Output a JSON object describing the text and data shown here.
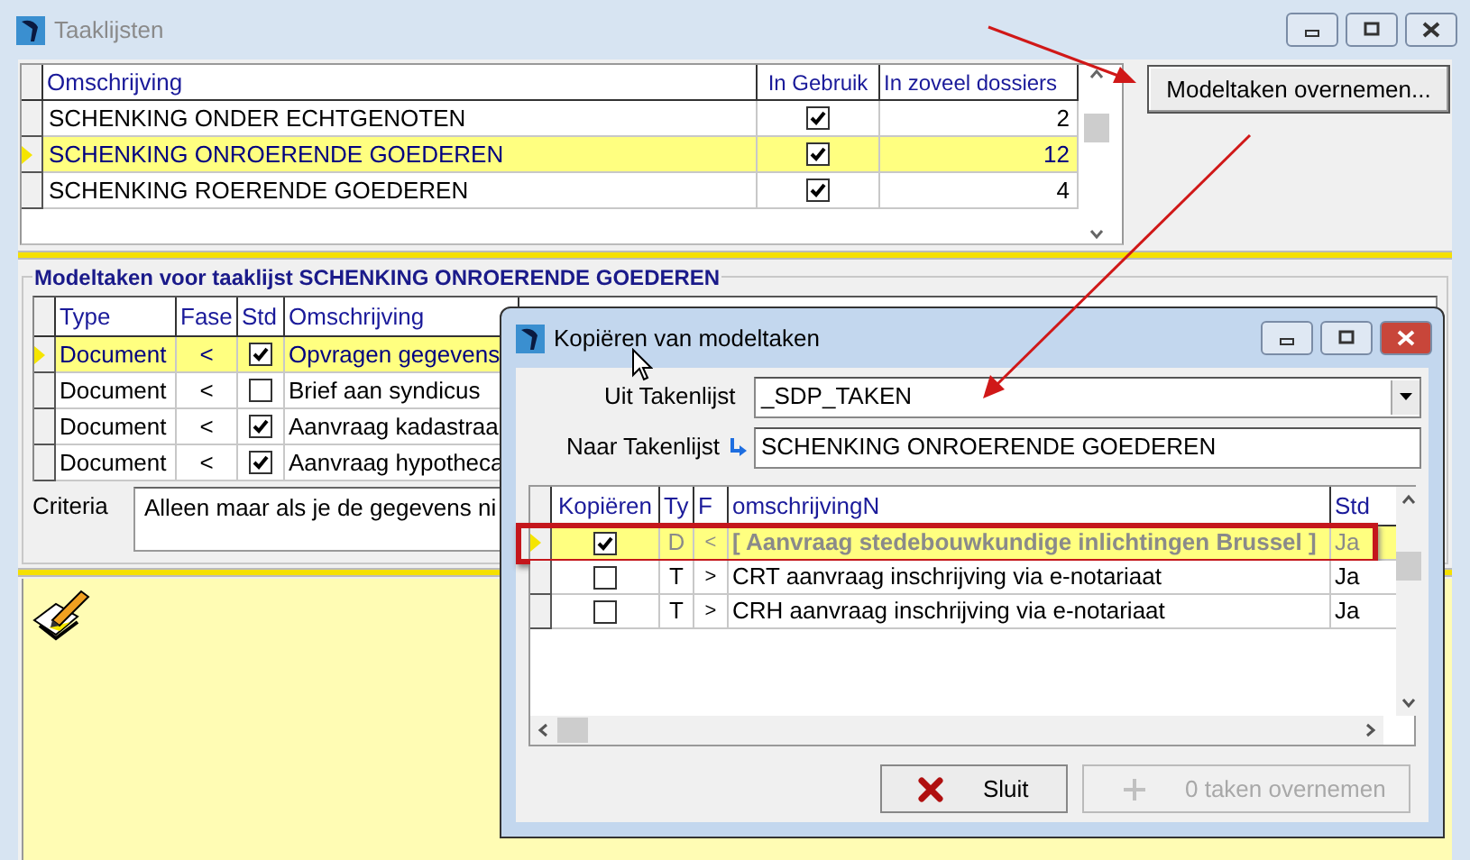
{
  "window": {
    "title": "Taaklijsten"
  },
  "tasklists": {
    "columns": [
      "Omschrijving",
      "In Gebruik",
      "In zoveel dossiers"
    ],
    "rows": [
      {
        "name": "SCHENKING ONDER ECHTGENOTEN",
        "in_use": true,
        "count": "2",
        "selected": false
      },
      {
        "name": "SCHENKING ONROERENDE GOEDEREN",
        "in_use": true,
        "count": "12",
        "selected": true
      },
      {
        "name": "SCHENKING ROERENDE GOEDEREN",
        "in_use": true,
        "count": "4",
        "selected": false
      }
    ]
  },
  "copy_button": "Modeltaken overnemen...",
  "model_tasks": {
    "title": "Modeltaken voor taaklijst SCHENKING ONROERENDE GOEDEREN",
    "columns": [
      "Type",
      "Fase",
      "Std",
      "Omschrijving"
    ],
    "rows": [
      {
        "type": "Document",
        "phase": "<",
        "std": true,
        "description": "Opvragen gegevens",
        "selected": true
      },
      {
        "type": "Document",
        "phase": "<",
        "std": false,
        "description": "Brief aan syndicus",
        "selected": false
      },
      {
        "type": "Document",
        "phase": "<",
        "std": true,
        "description": "Aanvraag kadastraa",
        "selected": false
      },
      {
        "type": "Document",
        "phase": "<",
        "std": true,
        "description": "Aanvraag hypotheca",
        "selected": false
      }
    ],
    "criteria_label": "Criteria",
    "criteria": "Alleen maar als je de gegevens ni"
  },
  "dialog": {
    "title": "Kopiëren van modeltaken",
    "from_label": "Uit Takenlijst",
    "from_value": "_SDP_TAKEN",
    "to_label": "Naar Takenlijst",
    "to_value": "SCHENKING ONROERENDE GOEDEREN",
    "columns": [
      "Kopiëren",
      "Ty",
      "F",
      "omschrijvingN",
      "Std"
    ],
    "rows": [
      {
        "copy": true,
        "type": "D",
        "phase": "<",
        "description": "[ Aanvraag stedebouwkundige inlichtingen Brussel ]",
        "std": "Ja",
        "selected": true,
        "greyed": true,
        "highlighted": true
      },
      {
        "copy": false,
        "type": "T",
        "phase": ">",
        "description": "CRT aanvraag inschrijving via e-notariaat",
        "std": "Ja",
        "selected": false,
        "greyed": false,
        "highlighted": false
      },
      {
        "copy": false,
        "type": "T",
        "phase": ">",
        "description": "CRH aanvraag inschrijving via e-notariaat",
        "std": "Ja",
        "selected": false,
        "greyed": false,
        "highlighted": false
      }
    ],
    "close_button": "Sluit",
    "apply_button": {
      "label": "0 taken overnemen",
      "disabled": true
    }
  }
}
